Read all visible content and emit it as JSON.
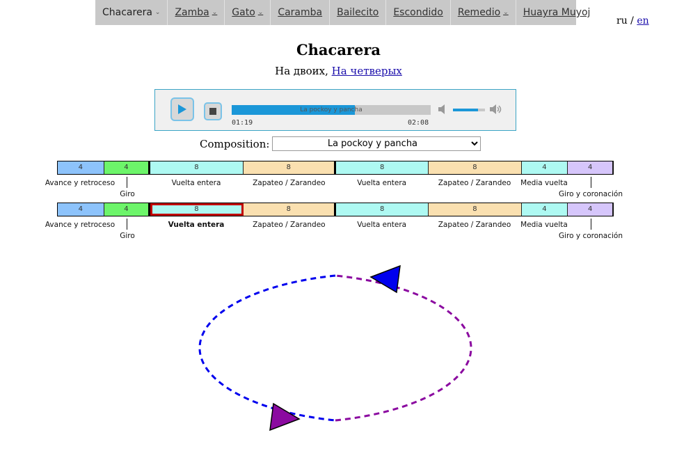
{
  "nav": [
    {
      "label": "Chacarera",
      "caret": true,
      "active": true
    },
    {
      "label": "Zamba",
      "caret": true
    },
    {
      "label": "Gato",
      "caret": true
    },
    {
      "label": "Caramba",
      "caret": false
    },
    {
      "label": "Bailecito",
      "caret": false
    },
    {
      "label": "Escondido",
      "caret": false
    },
    {
      "label": "Remedio",
      "caret": true
    },
    {
      "label": "Huayra Muyoj",
      "caret": false
    }
  ],
  "caret_glyph": "⌄",
  "lang": {
    "ru": "ru",
    "sep": "/",
    "en": "en"
  },
  "page": {
    "title": "Chacarera",
    "variant_current": "На двоих,",
    "variant_link": "На четверых"
  },
  "player": {
    "track": "La pockoy y pancha",
    "time_current": "01:19",
    "time_total": "02:08",
    "progress": 0.62,
    "volume": 0.78,
    "accent": "#1b97d8"
  },
  "composition": {
    "label": "Composition:",
    "selected": "La pockoy y pancha"
  },
  "timeline_rows": [
    {
      "segments": [
        {
          "beats": "4",
          "name": "Avance y retroceso",
          "color": "#8dc3fb"
        },
        {
          "beats": "4",
          "name": "Giro",
          "color": "#6df56a"
        },
        {
          "beats": "8",
          "name": "Vuelta entera",
          "color": "#aef9f2"
        },
        {
          "beats": "8",
          "name": "Zapateo / Zarandeo",
          "color": "#fae0b0"
        },
        {
          "beats": "8",
          "name": "Vuelta entera",
          "color": "#aef9f2"
        },
        {
          "beats": "8",
          "name": "Zapateo / Zarandeo",
          "color": "#fae0b0"
        },
        {
          "beats": "4",
          "name": "Media vuelta",
          "color": "#aef9f2"
        },
        {
          "beats": "4",
          "name": "Giro y coronación",
          "color": "#d6c6fb"
        }
      ]
    },
    {
      "segments": [
        {
          "beats": "4",
          "name": "Avance y retroceso",
          "color": "#8dc3fb"
        },
        {
          "beats": "4",
          "name": "Giro",
          "color": "#6df56a"
        },
        {
          "beats": "8",
          "name": "Vuelta entera",
          "color": "#aef9f2",
          "selected": true
        },
        {
          "beats": "8",
          "name": "Zapateo / Zarandeo",
          "color": "#fae0b0"
        },
        {
          "beats": "8",
          "name": "Vuelta entera",
          "color": "#aef9f2"
        },
        {
          "beats": "8",
          "name": "Zapateo / Zarandeo",
          "color": "#fae0b0"
        },
        {
          "beats": "4",
          "name": "Media vuelta",
          "color": "#aef9f2"
        },
        {
          "beats": "4",
          "name": "Giro y coronación",
          "color": "#d6c6fb"
        }
      ]
    }
  ],
  "dancers": {
    "blue": "#0000ee",
    "purple": "#8b0aa0"
  }
}
